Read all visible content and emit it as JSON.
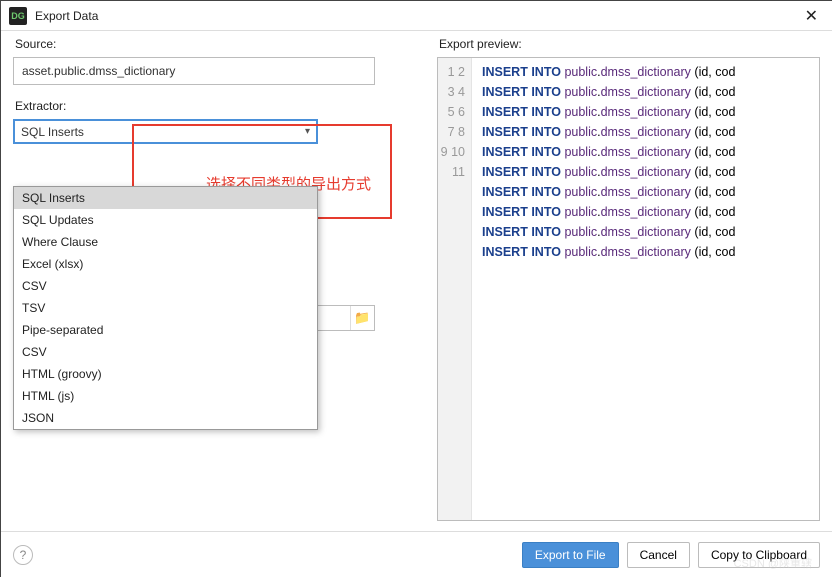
{
  "title": "Export Data",
  "left": {
    "sourceLabel": "Source:",
    "sourceValue": "asset.public.dmss_dictionary",
    "extractorLabel": "Extractor:",
    "extractorSelected": "SQL Inserts",
    "options": [
      "SQL Inserts",
      "SQL Updates",
      "Where Clause",
      "Excel (xlsx)",
      "CSV",
      "TSV",
      "Pipe-separated",
      "CSV",
      "HTML (groovy)",
      "HTML (js)",
      "JSON"
    ]
  },
  "preview": {
    "label": "Export preview:",
    "rows": 11,
    "linePrefixKw1": "INSERT",
    "linePrefixKw2": "INTO",
    "schema": "public",
    "table": "dmss_dictionary",
    "cols": "(id, cod"
  },
  "footer": {
    "help": "?",
    "export": "Export to File",
    "cancel": "Cancel",
    "copy": "Copy to Clipboard"
  },
  "annotation": "选择不同类型的导出方式",
  "watermark": "CSDN @陕重辖"
}
